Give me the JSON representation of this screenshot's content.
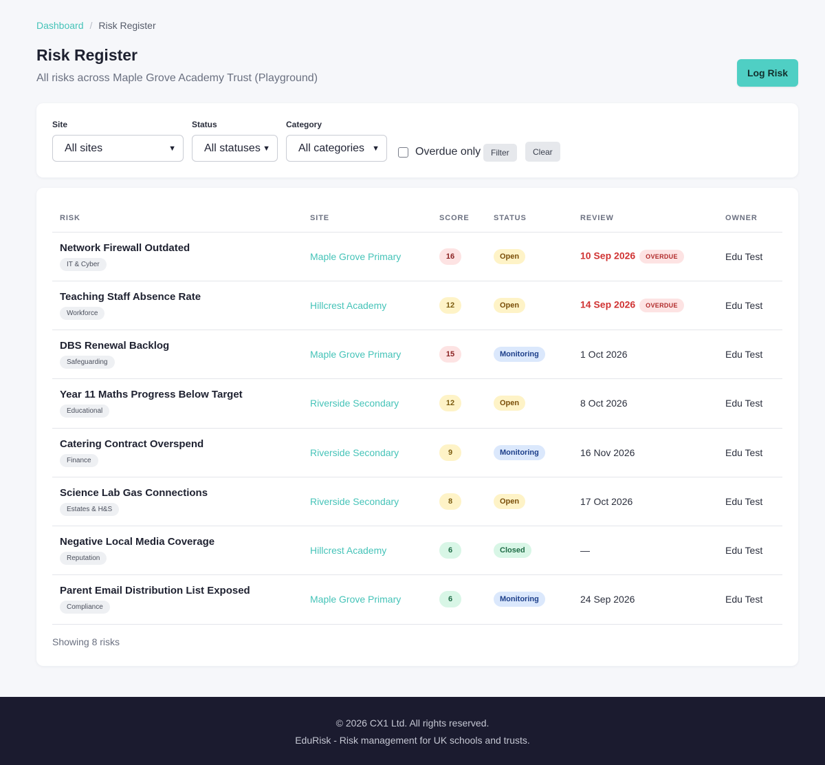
{
  "breadcrumb": {
    "root": "Dashboard",
    "separator": "/",
    "current": "Risk Register"
  },
  "header": {
    "title": "Risk Register",
    "subtitle": "All risks across Maple Grove Academy Trust (Playground)",
    "log_risk_label": "Log Risk"
  },
  "filters": {
    "site_label": "Site",
    "site_value": "All sites",
    "status_label": "Status",
    "status_value": "All statuses",
    "category_label": "Category",
    "category_value": "All categories",
    "overdue_label": "Overdue only",
    "overdue_checked": false,
    "filter_label": "Filter",
    "clear_label": "Clear"
  },
  "table": {
    "headers": [
      "RISK",
      "SITE",
      "SCORE",
      "STATUS",
      "REVIEW",
      "OWNER"
    ],
    "rows": [
      {
        "risk": "Network Firewall Outdated",
        "category": "IT & Cyber",
        "site": "Maple Grove Primary",
        "score": "16",
        "score_level": "high",
        "status": "Open",
        "status_key": "open",
        "review": "10 Sep 2026",
        "overdue": true,
        "owner": "Edu Test"
      },
      {
        "risk": "Teaching Staff Absence Rate",
        "category": "Workforce",
        "site": "Hillcrest Academy",
        "score": "12",
        "score_level": "med",
        "status": "Open",
        "status_key": "open",
        "review": "14 Sep 2026",
        "overdue": true,
        "owner": "Edu Test"
      },
      {
        "risk": "DBS Renewal Backlog",
        "category": "Safeguarding",
        "site": "Maple Grove Primary",
        "score": "15",
        "score_level": "high",
        "status": "Monitoring",
        "status_key": "monitoring",
        "review": "1 Oct 2026",
        "overdue": false,
        "owner": "Edu Test"
      },
      {
        "risk": "Year 11 Maths Progress Below Target",
        "category": "Educational",
        "site": "Riverside Secondary",
        "score": "12",
        "score_level": "med",
        "status": "Open",
        "status_key": "open",
        "review": "8 Oct 2026",
        "overdue": false,
        "owner": "Edu Test"
      },
      {
        "risk": "Catering Contract Overspend",
        "category": "Finance",
        "site": "Riverside Secondary",
        "score": "9",
        "score_level": "med",
        "status": "Monitoring",
        "status_key": "monitoring",
        "review": "16 Nov 2026",
        "overdue": false,
        "owner": "Edu Test"
      },
      {
        "risk": "Science Lab Gas Connections",
        "category": "Estates & H&S",
        "site": "Riverside Secondary",
        "score": "8",
        "score_level": "med",
        "status": "Open",
        "status_key": "open",
        "review": "17 Oct 2026",
        "overdue": false,
        "owner": "Edu Test"
      },
      {
        "risk": "Negative Local Media Coverage",
        "category": "Reputation",
        "site": "Hillcrest Academy",
        "score": "6",
        "score_level": "low",
        "status": "Closed",
        "status_key": "closed",
        "review": "—",
        "overdue": false,
        "owner": "Edu Test"
      },
      {
        "risk": "Parent Email Distribution List Exposed",
        "category": "Compliance",
        "site": "Maple Grove Primary",
        "score": "6",
        "score_level": "low",
        "status": "Monitoring",
        "status_key": "monitoring",
        "review": "24 Sep 2026",
        "overdue": false,
        "owner": "Edu Test"
      }
    ],
    "overdue_badge": "OVERDUE",
    "showing_text": "Showing 8 risks"
  },
  "footer": {
    "copyright": "© 2026 CX1 Ltd. All rights reserved.",
    "tagline": "EduRisk - Risk management for UK schools and trusts."
  },
  "colors": {
    "accent": "#4fcfc4",
    "link": "#45c3b8",
    "overdue": "#d03333",
    "footer_bg": "#1b1b2f"
  }
}
